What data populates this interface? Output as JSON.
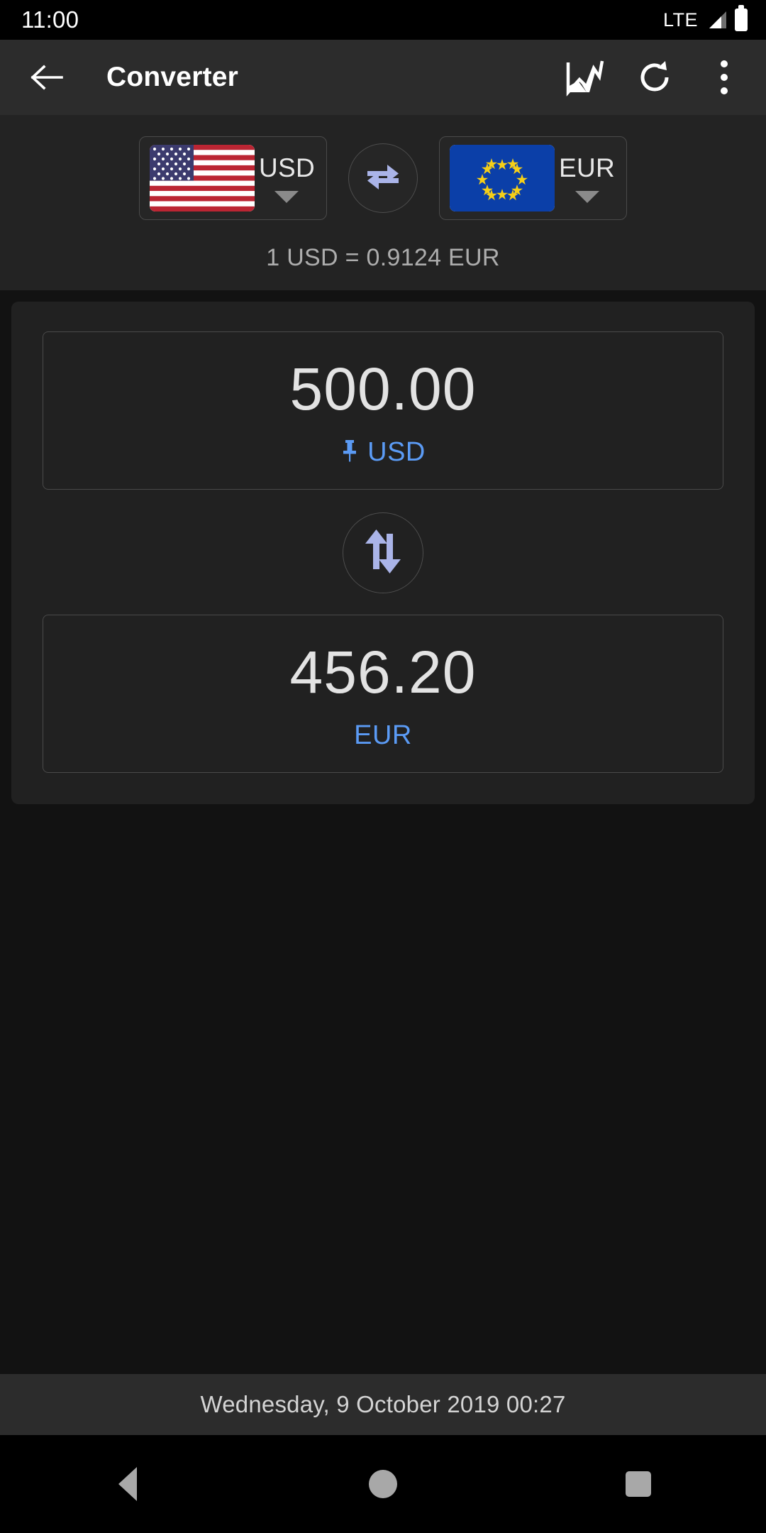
{
  "status_bar": {
    "time": "11:00",
    "network_label": "LTE",
    "signal_icon": "signal-bars-icon",
    "battery_icon": "battery-full-icon"
  },
  "app_bar": {
    "back_icon": "arrow-left-icon",
    "title": "Converter",
    "chart_icon": "line-chart-icon",
    "refresh_icon": "refresh-icon",
    "overflow_icon": "more-vertical-icon"
  },
  "selector": {
    "from": {
      "code": "USD",
      "flag_icon": "flag-usa-icon",
      "caret_icon": "chevron-down-icon"
    },
    "to": {
      "code": "EUR",
      "flag_icon": "flag-eu-icon",
      "caret_icon": "chevron-down-icon"
    },
    "swap_icon": "swap-horizontal-icon",
    "rate_text": "1 USD = 0.9124 EUR"
  },
  "converter": {
    "from_amount": {
      "value": "500.00",
      "currency": "USD",
      "pin_icon": "pin-icon",
      "pinned": true
    },
    "swap_icon": "swap-vertical-icon",
    "to_amount": {
      "value": "456.20",
      "currency": "EUR",
      "pinned": false
    }
  },
  "footer": {
    "timestamp": "Wednesday, 9 October 2019 00:27"
  },
  "nav_bar": {
    "back_icon": "nav-back-icon",
    "home_icon": "nav-home-icon",
    "recents_icon": "nav-recents-icon"
  },
  "colors": {
    "accent_blue": "#5b9bf5",
    "swap_arrow": "#aab4e8",
    "flag_eu_blue": "#0b3fa8",
    "flag_eu_star": "#f5cf18",
    "flag_us_red": "#bb2533"
  }
}
